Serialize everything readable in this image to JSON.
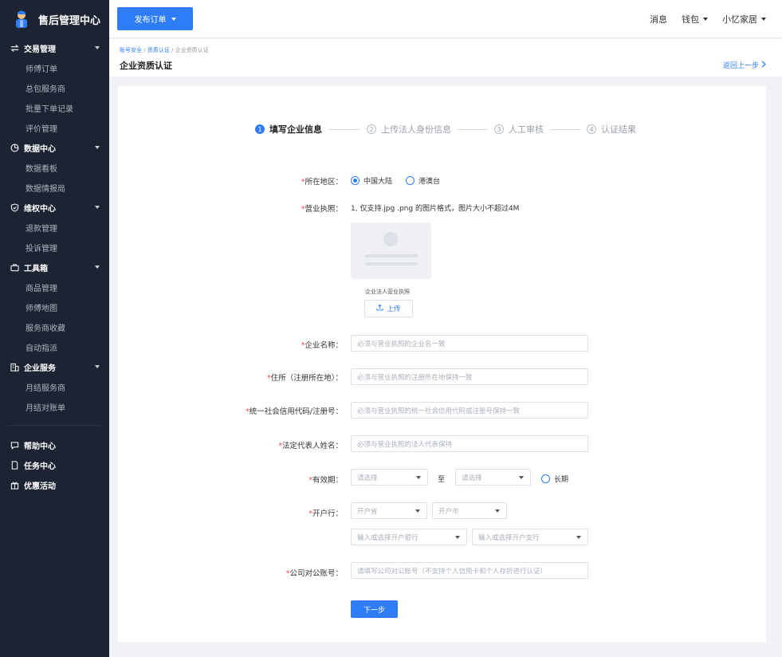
{
  "brand": {
    "title": "售后管理中心"
  },
  "sidebar": {
    "groups": [
      {
        "label": "交易管理",
        "items": [
          "师傅订单",
          "总包服务商",
          "批量下单记录",
          "评价管理"
        ]
      },
      {
        "label": "数据中心",
        "items": [
          "数据看板",
          "数据情报局"
        ]
      },
      {
        "label": "维权中心",
        "items": [
          "退款管理",
          "投诉管理"
        ]
      },
      {
        "label": "工具箱",
        "items": [
          "商品管理",
          "师傅地图",
          "服务商收藏",
          "自动指派"
        ]
      },
      {
        "label": "企业服务",
        "items": [
          "月结服务商",
          "月结对账单"
        ]
      }
    ],
    "bottom": [
      "帮助中心",
      "任务中心",
      "优惠活动"
    ]
  },
  "topbar": {
    "publish_label": "发布订单",
    "messages": "消息",
    "wallet": "钱包",
    "user": "小忆家居"
  },
  "header": {
    "breadcrumb": [
      "账号安全",
      "资质认证",
      "企业资质认证"
    ],
    "title": "企业资质认证",
    "back": "返回上一步"
  },
  "steps": [
    {
      "num": "1",
      "label": "填写企业信息"
    },
    {
      "num": "2",
      "label": "上传法人身份信息"
    },
    {
      "num": "3",
      "label": "人工审核"
    },
    {
      "num": "4",
      "label": "认证结果"
    }
  ],
  "form": {
    "region": {
      "label": "所在地区：",
      "options": [
        "中国大陆",
        "港澳台"
      ]
    },
    "license": {
      "label": "营业执照：",
      "note": "1, 仅支持.jpg .png 的图片格式，图片大小不超过4M",
      "caption": "企业法人营业执照",
      "upload": "上传"
    },
    "company_name": {
      "label": "企业名称：",
      "placeholder": "必须与营业执照的企业名一致"
    },
    "address": {
      "label": "住所（注册所在地）：",
      "placeholder": "必须与营业执照的注册所在地保持一致"
    },
    "credit_code": {
      "label": "统一社会信用代码/注册号：",
      "placeholder": "必须与营业执照的统一社会信用代码或注册号保持一致"
    },
    "legal_rep": {
      "label": "法定代表人姓名：",
      "placeholder": "必须与营业执照的法人代表保持"
    },
    "validity": {
      "label": "有效期：",
      "start": "请选择",
      "to": "至",
      "end": "请选择",
      "long_term": "长期"
    },
    "bank": {
      "label": "开户行：",
      "province": "开户省",
      "city": "开户市",
      "bank": "输入或选择开户银行",
      "branch": "输入或选择开户支行"
    },
    "account": {
      "label": "公司对公账号：",
      "placeholder": "请填写公司对公账号（不支持个人信用卡和个人存折进行认证）"
    },
    "next": "下一步"
  }
}
